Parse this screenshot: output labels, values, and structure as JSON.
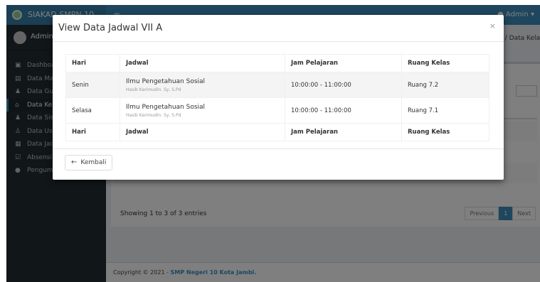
{
  "app": {
    "brand": "SIAKAD SMPN 10",
    "top_user": "Admin",
    "user_panel_name": "Admin",
    "breadcrumb": "e / Data Kela"
  },
  "sidebar": {
    "items": [
      {
        "label": "Dashboard",
        "icon": "dashboard-icon"
      },
      {
        "label": "Data Mapel",
        "icon": "book-icon"
      },
      {
        "label": "Data Guru",
        "icon": "users-icon"
      },
      {
        "label": "Data Kelas",
        "icon": "home-icon"
      },
      {
        "label": "Data Siswa",
        "icon": "users-icon"
      },
      {
        "label": "Data User",
        "icon": "user-plus-icon"
      },
      {
        "label": "Data Jadwal",
        "icon": "calendar-icon"
      },
      {
        "label": "Absensi",
        "icon": "check-square-icon"
      },
      {
        "label": "Pengumuman",
        "icon": "info-icon"
      }
    ]
  },
  "background": {
    "showing": "Showing 1 to 3 of 3 entries",
    "pager": {
      "previous": "Previous",
      "page": "1",
      "next": "Next"
    },
    "footer_prefix": "Copyright © 2021 - ",
    "footer_brand": "SMP Negeri 10 Kota Jambi."
  },
  "modal": {
    "title": "View Data Jadwal VII A",
    "close": "×",
    "columns": [
      "Hari",
      "Jadwal",
      "Jam Pelajaran",
      "Ruang Kelas"
    ],
    "rows": [
      {
        "hari": "Senin",
        "subject": "Ilmu Pengetahuan Sosial",
        "teacher": "Hasib Karimudin. Sy, S.Pd",
        "jam": "10:00:00 - 11:00:00",
        "ruang": "Ruang 7.2"
      },
      {
        "hari": "Selasa",
        "subject": "Ilmu Pengetahuan Sosial",
        "teacher": "Hasib Karimudin. Sy, S.Pd",
        "jam": "10:00:00 - 11:00:00",
        "ruang": "Ruang 7.1"
      }
    ],
    "back_label": "Kembali"
  }
}
